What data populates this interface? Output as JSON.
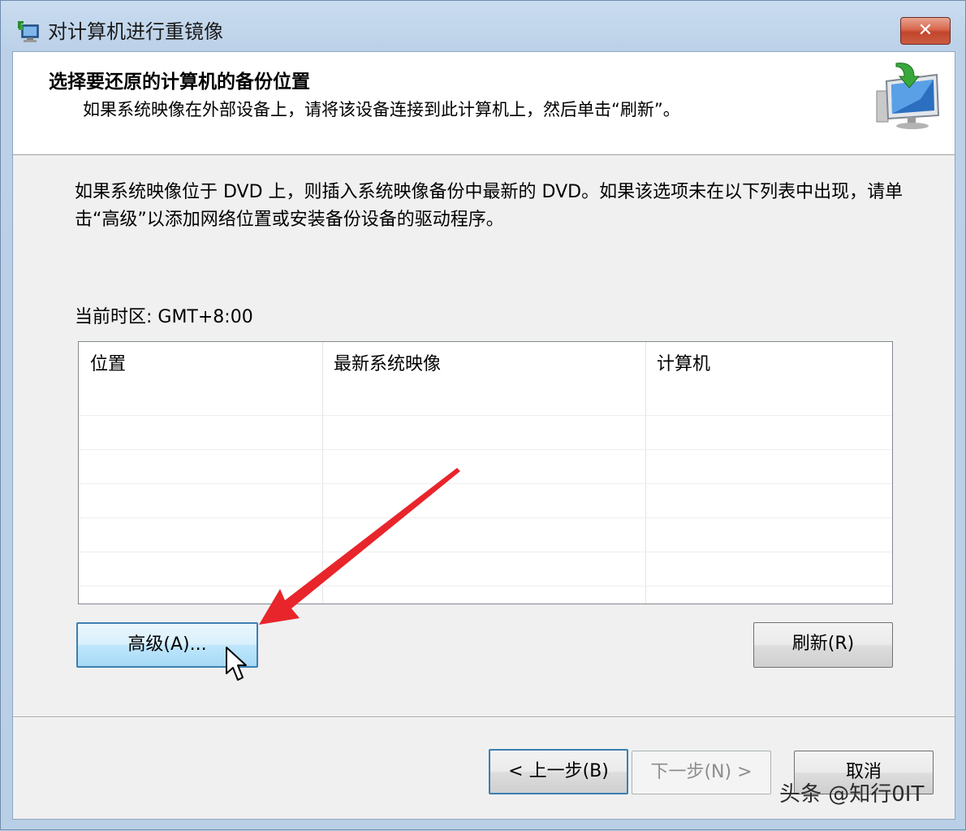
{
  "window": {
    "title": "对计算机进行重镜像",
    "close_label": "✕"
  },
  "header": {
    "title": "选择要还原的计算机的备份位置",
    "subtitle": "如果系统映像在外部设备上，请将该设备连接到此计算机上，然后单击“刷新”。"
  },
  "instructions": "如果系统映像位于 DVD 上，则插入系统映像备份中最新的 DVD。如果该选项未在以下列表中出现，请单击“高级”以添加网络位置或安装备份设备的驱动程序。",
  "timezone": "当前时区: GMT+8:00",
  "table": {
    "columns": [
      "位置",
      "最新系统映像",
      "计算机"
    ],
    "rows": []
  },
  "buttons": {
    "advanced": "高级(A)...",
    "refresh": "刷新(R)",
    "back": "< 上一步(B)",
    "next": "下一步(N) >",
    "cancel": "取消"
  },
  "watermark": "头条 @知行0IT",
  "colors": {
    "arrow": "#e8252b",
    "title_bar": "#c5d9ef",
    "close_button": "#cf5a40",
    "focus_border": "#3c7fb1"
  }
}
